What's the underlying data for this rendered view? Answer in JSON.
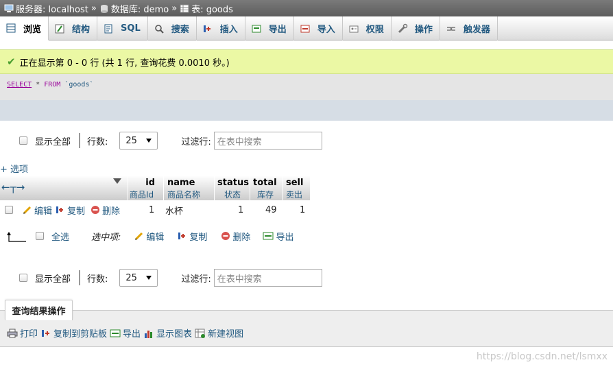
{
  "breadcrumb": {
    "server": "服务器: localhost",
    "database": "数据库: demo",
    "table": "表: goods",
    "separator": "»"
  },
  "tabs": [
    {
      "label": "浏览",
      "icon": "browse-icon",
      "active": true
    },
    {
      "label": "结构",
      "icon": "structure-icon"
    },
    {
      "label": "SQL",
      "icon": "sql-icon"
    },
    {
      "label": "搜索",
      "icon": "search-icon"
    },
    {
      "label": "插入",
      "icon": "insert-icon"
    },
    {
      "label": "导出",
      "icon": "export-icon"
    },
    {
      "label": "导入",
      "icon": "import-icon"
    },
    {
      "label": "权限",
      "icon": "privileges-icon"
    },
    {
      "label": "操作",
      "icon": "wrench-icon"
    },
    {
      "label": "触发器",
      "icon": "triggers-icon"
    }
  ],
  "success_message": "正在显示第 0 - 0 行 (共 1 行, 查询花费 0.0010 秒。)",
  "sql": {
    "select": "SELECT",
    "rest1": "*",
    "from": "FROM",
    "table": "`goods`"
  },
  "nav": {
    "show_all": "显示全部",
    "rows_label": "行数:",
    "rows_value": "25",
    "filter_label": "过滤行:",
    "filter_placeholder": "在表中搜索"
  },
  "options_link": "+ 选项",
  "table": {
    "columns": [
      {
        "name": "id",
        "comment": "商品Id"
      },
      {
        "name": "name",
        "comment": "商品名称"
      },
      {
        "name": "status",
        "comment": "状态"
      },
      {
        "name": "total",
        "comment": "库存"
      },
      {
        "name": "sell",
        "comment": "卖出"
      }
    ],
    "rows": [
      {
        "id": "1",
        "name": "水杯",
        "status": "1",
        "total": "49",
        "sell": "1"
      }
    ],
    "row_actions": {
      "edit": "编辑",
      "copy": "复制",
      "delete": "删除"
    }
  },
  "bulk": {
    "check_all": "全选",
    "selected": "选中项:",
    "edit": "编辑",
    "copy": "复制",
    "delete": "删除",
    "export": "导出"
  },
  "query_ops": {
    "title": "查询结果操作",
    "print": "打印",
    "copy_clipboard": "复制到剪贴板",
    "export": "导出",
    "chart": "显示图表",
    "create_view": "新建视图"
  },
  "watermark": "https://blog.csdn.net/lsmxx"
}
